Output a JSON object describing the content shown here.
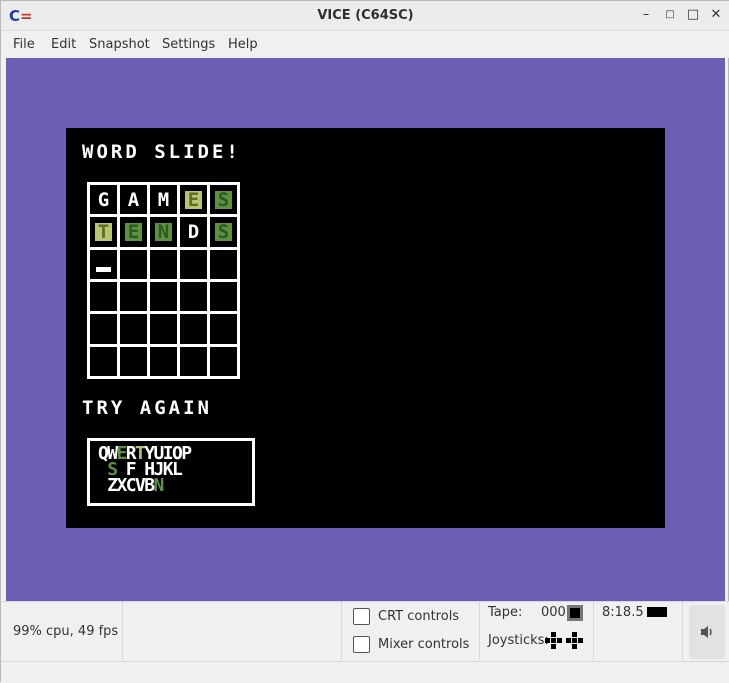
{
  "window": {
    "title": "VICE (C64SC)",
    "minimize": "–",
    "maximize": "□",
    "close": "✕",
    "logo": "C="
  },
  "menu": [
    "File",
    "Edit",
    "Snapshot",
    "Settings",
    "Help"
  ],
  "screen": {
    "title": "WORD SLIDE!",
    "grid": [
      [
        {
          "l": "G",
          "s": "none"
        },
        {
          "l": "A",
          "s": "none"
        },
        {
          "l": "M",
          "s": "none"
        },
        {
          "l": "E",
          "s": "present"
        },
        {
          "l": "S",
          "s": "correct"
        }
      ],
      [
        {
          "l": "T",
          "s": "present"
        },
        {
          "l": "E",
          "s": "correct"
        },
        {
          "l": "N",
          "s": "correct"
        },
        {
          "l": "D",
          "s": "none"
        },
        {
          "l": "S",
          "s": "correct"
        }
      ],
      [
        {
          "l": "_",
          "s": "cursor"
        },
        {
          "l": "",
          "s": "none"
        },
        {
          "l": "",
          "s": "none"
        },
        {
          "l": "",
          "s": "none"
        },
        {
          "l": "",
          "s": "none"
        }
      ],
      [
        {
          "l": "",
          "s": "none"
        },
        {
          "l": "",
          "s": "none"
        },
        {
          "l": "",
          "s": "none"
        },
        {
          "l": "",
          "s": "none"
        },
        {
          "l": "",
          "s": "none"
        }
      ],
      [
        {
          "l": "",
          "s": "none"
        },
        {
          "l": "",
          "s": "none"
        },
        {
          "l": "",
          "s": "none"
        },
        {
          "l": "",
          "s": "none"
        },
        {
          "l": "",
          "s": "none"
        }
      ],
      [
        {
          "l": "",
          "s": "none"
        },
        {
          "l": "",
          "s": "none"
        },
        {
          "l": "",
          "s": "none"
        },
        {
          "l": "",
          "s": "none"
        },
        {
          "l": "",
          "s": "none"
        }
      ]
    ],
    "message": "TRY AGAIN",
    "keyboard": [
      [
        [
          "Q",
          "w"
        ],
        [
          "W",
          "w"
        ],
        [
          "E",
          "g"
        ],
        [
          "R",
          "w"
        ],
        [
          "T",
          "y"
        ],
        [
          "Y",
          "w"
        ],
        [
          "U",
          "w"
        ],
        [
          "I",
          "w"
        ],
        [
          "O",
          "w"
        ],
        [
          "P",
          "w"
        ]
      ],
      [
        [
          " ",
          "w"
        ],
        [
          "S",
          "g"
        ],
        [
          " ",
          "w"
        ],
        [
          "F",
          "w"
        ],
        [
          " ",
          "w"
        ],
        [
          "H",
          "w"
        ],
        [
          "J",
          "w"
        ],
        [
          "K",
          "w"
        ],
        [
          "L",
          "w"
        ]
      ],
      [
        [
          " ",
          "w"
        ],
        [
          "Z",
          "w"
        ],
        [
          "X",
          "w"
        ],
        [
          "C",
          "w"
        ],
        [
          "V",
          "w"
        ],
        [
          "B",
          "w"
        ],
        [
          "N",
          "g"
        ]
      ]
    ]
  },
  "colors": {
    "border": "#6c5eb5",
    "correct": "#5c9142",
    "present": "#b6c570",
    "text": "#ffffff",
    "bg": "#000000"
  },
  "status": {
    "cpu": "99% cpu, 49 fps",
    "crt": "CRT controls",
    "mixer": "Mixer controls",
    "tape_label": "Tape:",
    "tape_counter": "000",
    "joysticks": "Joysticks:",
    "time": "8:18.5",
    "volume_icon": "speaker-icon"
  }
}
